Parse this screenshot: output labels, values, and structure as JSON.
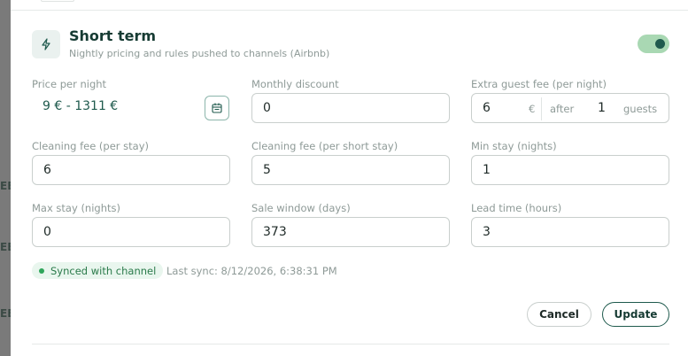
{
  "backdrop": {
    "frag1": "EE",
    "frag2": "EE",
    "frag3": "EE"
  },
  "header": {
    "title": "Short term",
    "subtitle": "Nightly pricing and rules pushed to channels (Airbnb)",
    "lightning_icon": "lightning-icon",
    "enabled": true
  },
  "fields": {
    "price_per_night": {
      "label": "Price per night",
      "value": "9 € - 1311 €",
      "icon": "calendar-icon"
    },
    "monthly_discount": {
      "label": "Monthly discount",
      "value": "0"
    },
    "extra_guest_fee": {
      "label": "Extra guest fee (per night)",
      "value": "6",
      "unit": "€",
      "after": "after",
      "count": "1",
      "guests": "guests"
    },
    "cleaning_fee": {
      "label": "Cleaning fee (per stay)",
      "value": "6"
    },
    "cleaning_fee_short": {
      "label": "Cleaning fee (per short stay)",
      "value": "5"
    },
    "min_stay": {
      "label": "Min stay (nights)",
      "value": "1"
    },
    "max_stay": {
      "label": "Max stay (nights)",
      "value": "0"
    },
    "sale_window": {
      "label": "Sale window (days)",
      "value": "373"
    },
    "lead_time": {
      "label": "Lead time (hours)",
      "value": "3"
    }
  },
  "sync": {
    "badge": "Synced with channel",
    "last_sync": "Last sync: 8/12/2026, 6:38:31 PM"
  },
  "actions": {
    "cancel": "Cancel",
    "update": "Update"
  },
  "colors": {
    "accent": "#1f5a4d",
    "toggle_on": "#a9d8b3",
    "sync_green": "#2fa55a"
  }
}
